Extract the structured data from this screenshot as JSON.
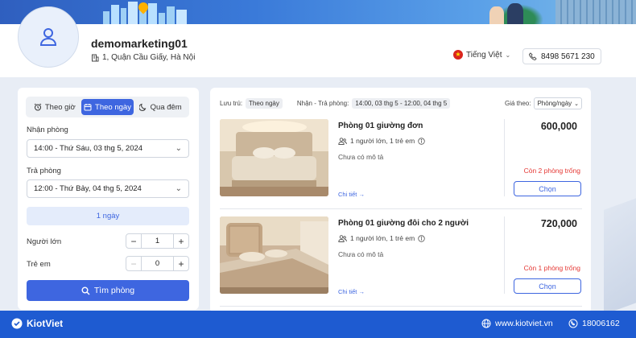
{
  "store": {
    "name": "demomarketing01",
    "address": "1, Quận Cầu Giấy, Hà Nội"
  },
  "header": {
    "language": "Tiếng Việt",
    "phone": "8498 5671 230"
  },
  "booking": {
    "tabs": [
      {
        "label": "Theo giờ",
        "icon": "alarm-clock-icon",
        "active": false
      },
      {
        "label": "Theo ngày",
        "icon": "calendar-icon",
        "active": true
      },
      {
        "label": "Qua đêm",
        "icon": "moon-icon",
        "active": false
      }
    ],
    "checkin_label": "Nhận phòng",
    "checkin_value": "14:00 - Thứ Sáu, 03 thg 5, 2024",
    "checkout_label": "Trả phòng",
    "checkout_value": "12:00 - Thứ Bảy, 04 thg 5, 2024",
    "nights": "1 ngày",
    "adults_label": "Người lớn",
    "adults_value": "1",
    "children_label": "Trẻ em",
    "children_value": "0",
    "search_label": "Tìm phòng"
  },
  "filters": {
    "stay_label": "Lưu trú:",
    "stay_value": "Theo ngày",
    "range_label": "Nhận - Trả phòng:",
    "range_value": "14:00, 03 thg 5 - 12:00, 04 thg 5",
    "sort_label": "Giá theo:",
    "sort_value": "Phòng/ngày"
  },
  "rooms": [
    {
      "name": "Phòng 01 giường đơn",
      "guests": "1 người lớn, 1 trẻ em",
      "description": "Chưa có mô tả",
      "detail_label": "Chi tiết",
      "price": "600,000",
      "availability": "Còn 2 phòng trống",
      "choose_label": "Chọn"
    },
    {
      "name": "Phòng 01 giường đôi cho 2 người",
      "guests": "1 người lớn, 1 trẻ em",
      "description": "Chưa có mô tả",
      "detail_label": "Chi tiết",
      "price": "720,000",
      "availability": "Còn 1 phòng trống",
      "choose_label": "Chọn"
    }
  ],
  "footer": {
    "brand": "KiotViet",
    "website": "www.kiotviet.vn",
    "hotline": "18006162"
  },
  "colors": {
    "primary": "#3e66e0",
    "footer": "#1e5bd1",
    "alert": "#e53935"
  }
}
